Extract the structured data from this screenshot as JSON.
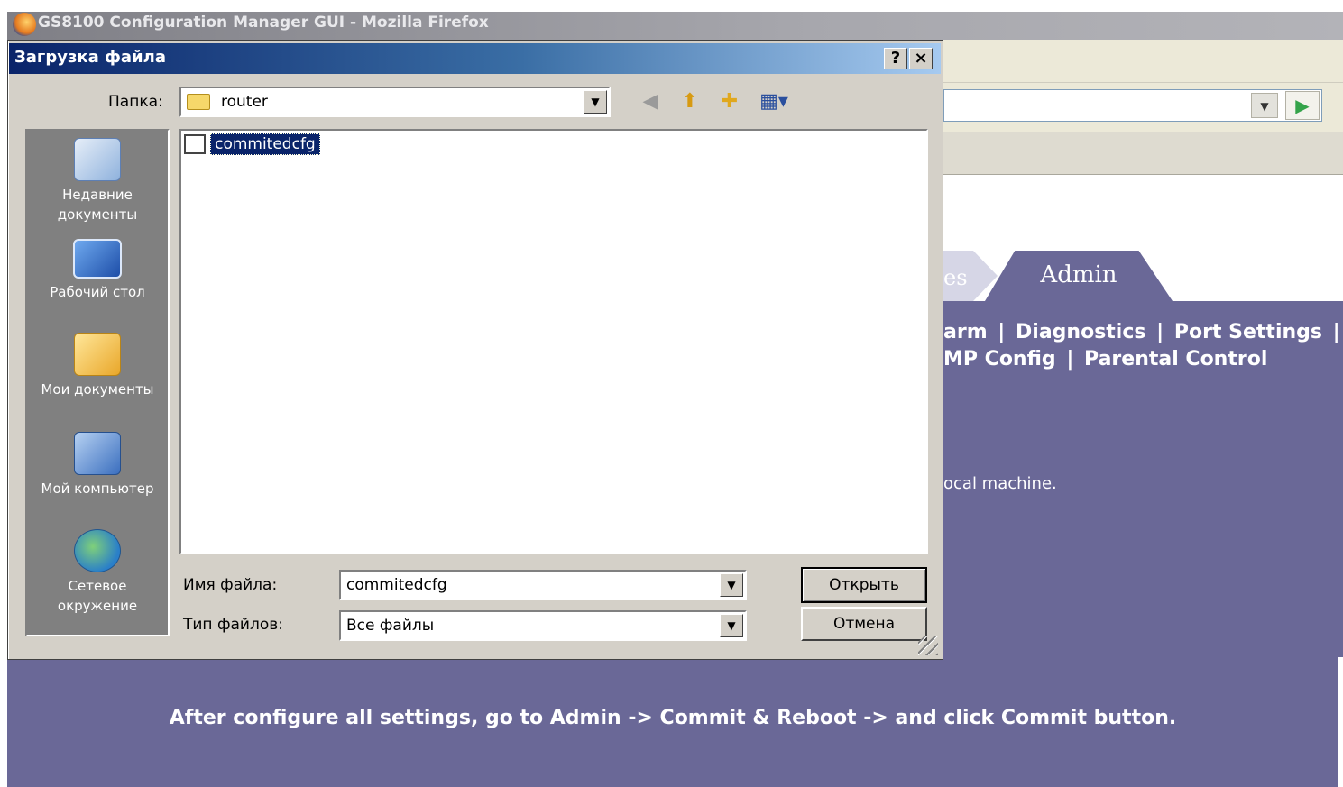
{
  "browser": {
    "window_title": "GS8100 Configuration Manager GUI - Mozilla Firefox"
  },
  "router_page": {
    "tabs": [
      {
        "label": "es"
      },
      {
        "label": "Admin",
        "active": true
      }
    ],
    "nav_row1": [
      "arm",
      "|",
      "Diagnostics",
      "|",
      "Port Settings",
      "|"
    ],
    "nav_row2": [
      "MP Config",
      "|",
      "Parental Control"
    ],
    "local_message": "ocal machine.",
    "footer_message": "After configure all settings, go to Admin -> Commit & Reboot -> and click Commit button.",
    "colors": {
      "panel": "#6a6897",
      "text": "#ffffff"
    }
  },
  "dialog": {
    "title": "Загрузка файла",
    "help_button": "?",
    "close_button": "×",
    "folder_label": "Папка:",
    "folder_value": "router",
    "toolbar_icons": [
      "back-icon",
      "up-folder-icon",
      "new-folder-icon",
      "view-menu-icon"
    ],
    "places": [
      {
        "label": "Недавние документы",
        "icon": "recent-documents-icon"
      },
      {
        "label": "Рабочий стол",
        "icon": "desktop-icon"
      },
      {
        "label": "Мои документы",
        "icon": "my-documents-icon"
      },
      {
        "label": "Мой компьютер",
        "icon": "my-computer-icon"
      },
      {
        "label": "Сетевое окружение",
        "icon": "network-icon"
      }
    ],
    "files": [
      {
        "name": "commitedcfg",
        "selected": true
      }
    ],
    "filename_label": "Имя файла:",
    "filename_value": "commitedcfg",
    "filetype_label": "Тип файлов:",
    "filetype_value": "Все файлы",
    "open_button": "Открыть",
    "cancel_button": "Отмена"
  }
}
